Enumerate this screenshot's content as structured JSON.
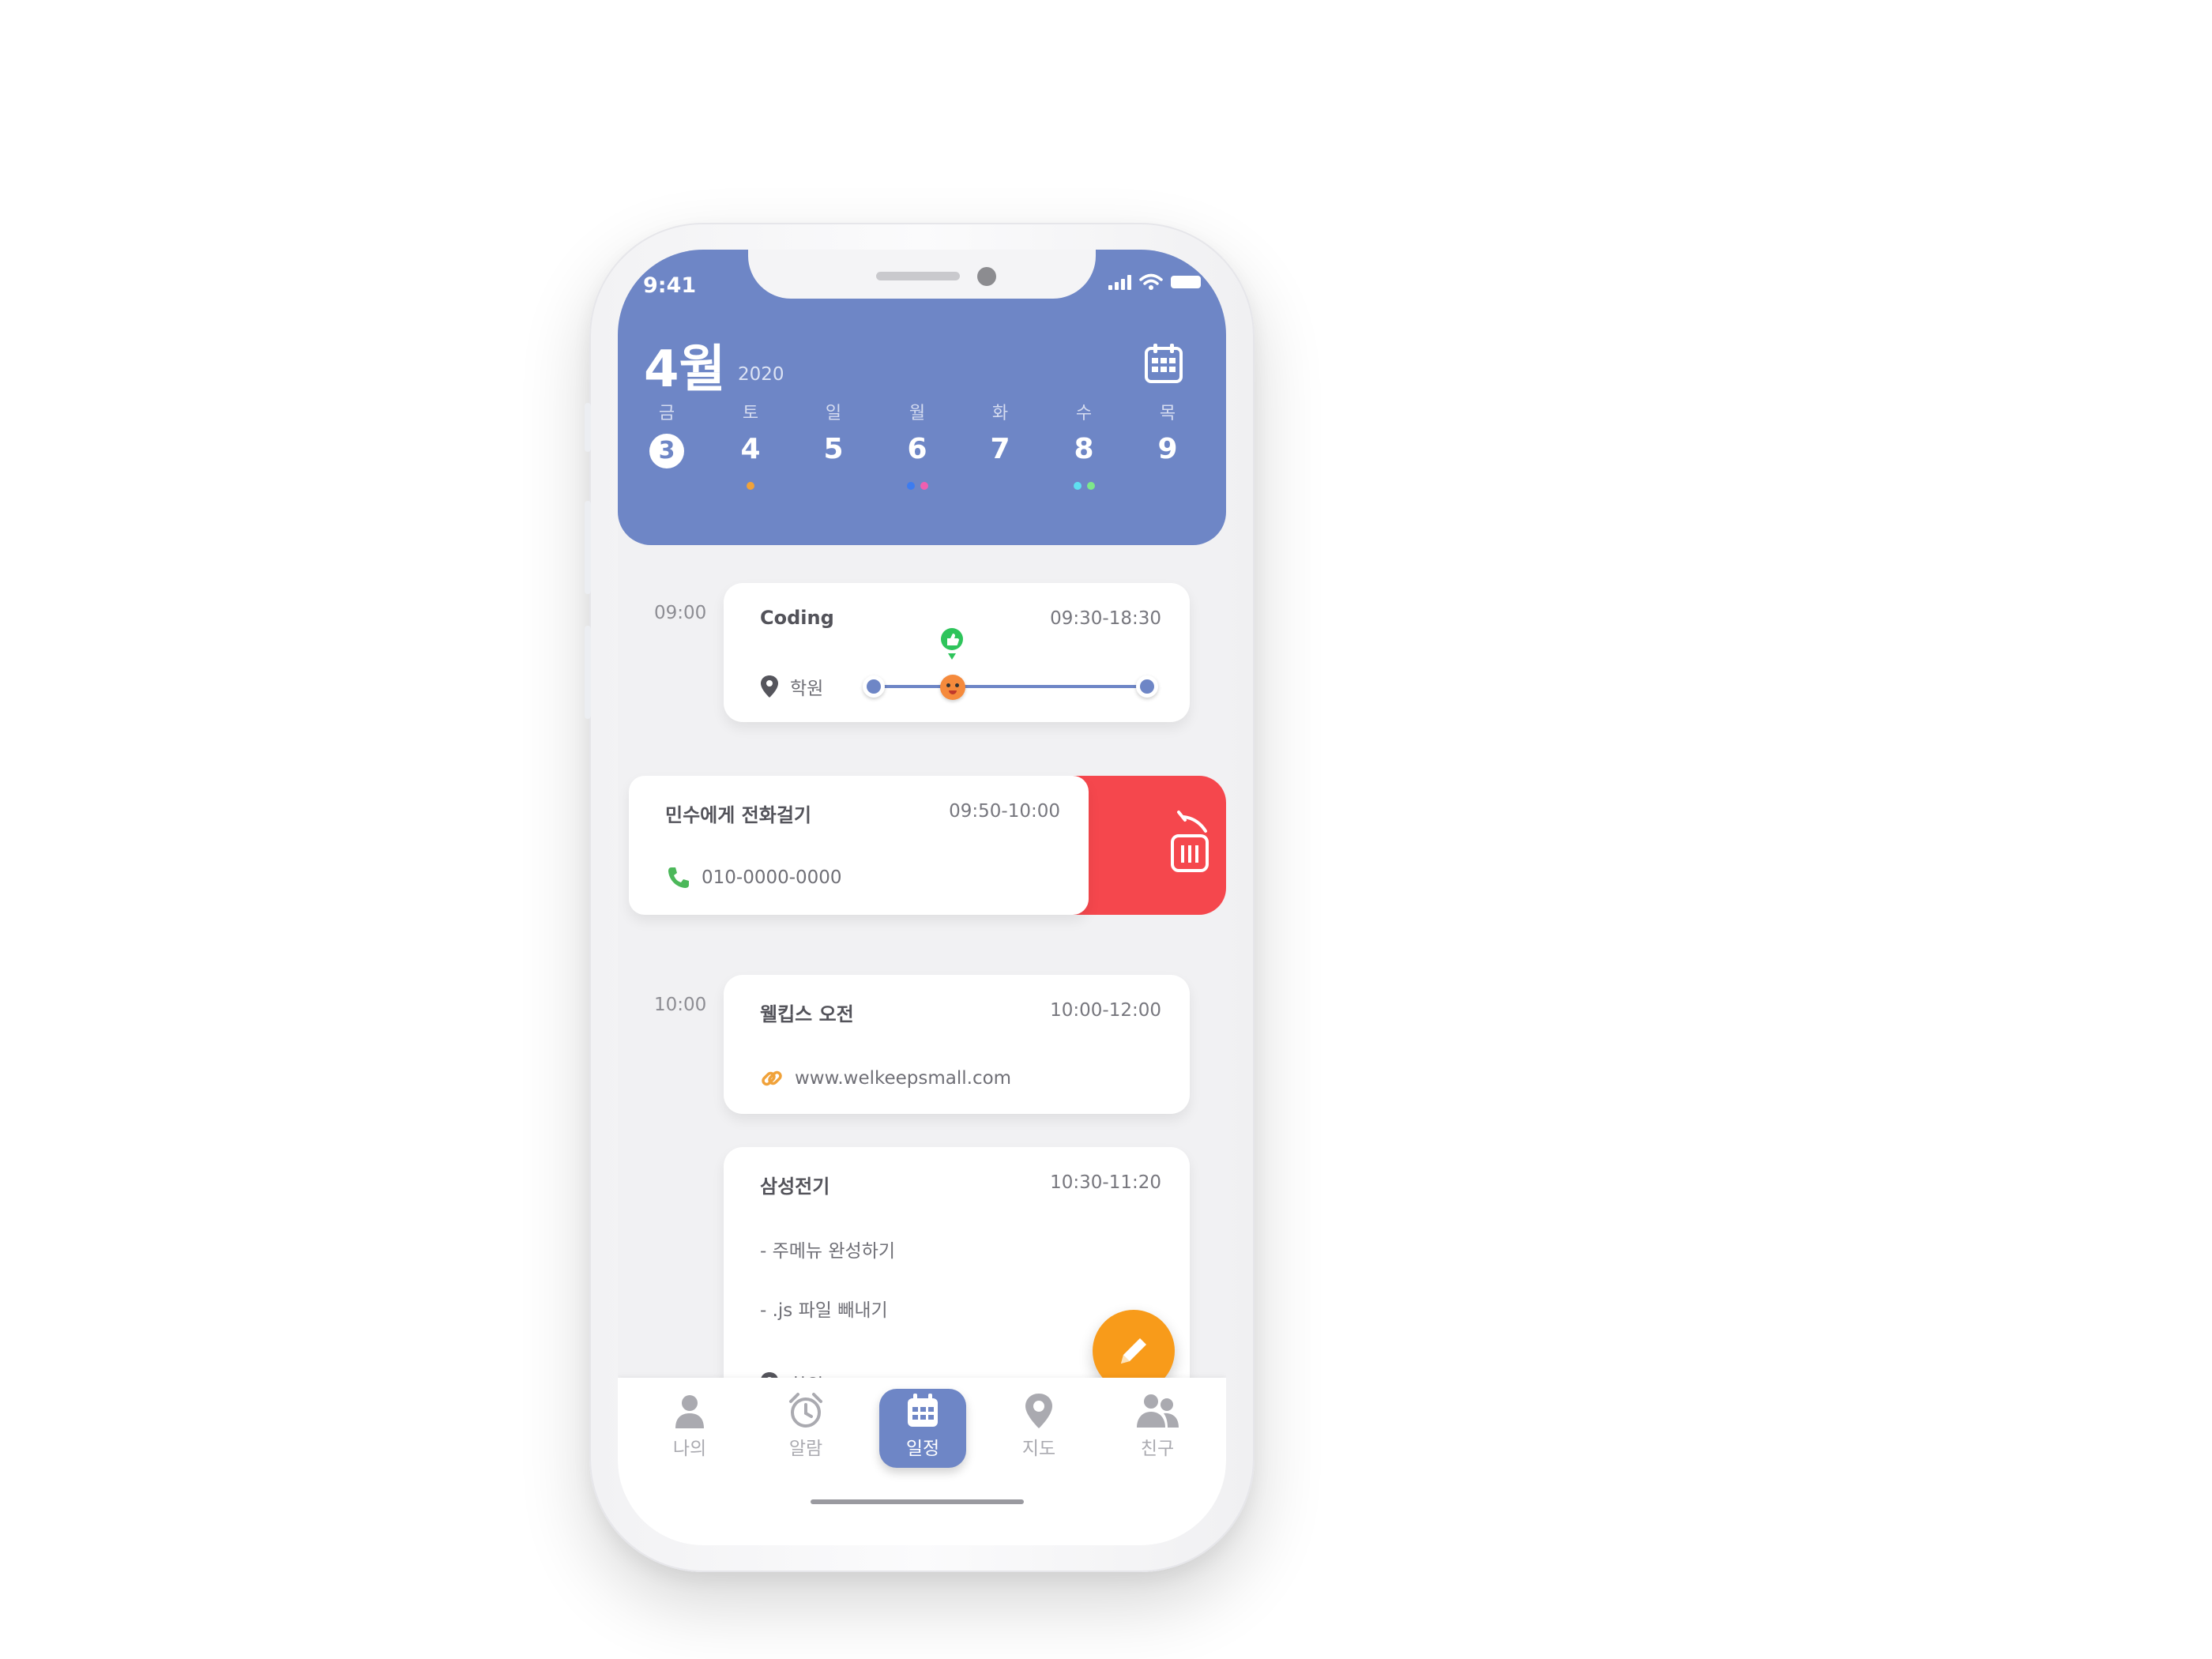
{
  "status_bar": {
    "time": "9:41"
  },
  "header": {
    "month": "4월",
    "year": "2020"
  },
  "week": [
    {
      "weekday": "금",
      "date": "3",
      "today": true,
      "dots": []
    },
    {
      "weekday": "토",
      "date": "4",
      "today": false,
      "dots": [
        "#f0a23a"
      ]
    },
    {
      "weekday": "일",
      "date": "5",
      "today": false,
      "dots": []
    },
    {
      "weekday": "월",
      "date": "6",
      "today": false,
      "dots": [
        "#3d7cf0",
        "#f05fb0"
      ]
    },
    {
      "weekday": "화",
      "date": "7",
      "today": false,
      "dots": []
    },
    {
      "weekday": "수",
      "date": "8",
      "today": false,
      "dots": [
        "#5fe0f0",
        "#7ee88a"
      ]
    },
    {
      "weekday": "목",
      "date": "9",
      "today": false,
      "dots": []
    }
  ],
  "time_labels": {
    "t1": "09:00",
    "t2": "10:00"
  },
  "events": {
    "coding": {
      "title": "Coding",
      "time": "09:30-18:30",
      "location": "학원",
      "progress": 0.29
    },
    "call": {
      "title": "민수에게 전화걸기",
      "time": "09:50-10:00",
      "phone": "010-0000-0000"
    },
    "welkeeps": {
      "title": "웰킵스 오전",
      "time": "10:00-12:00",
      "link": "www.welkeepsmall.com"
    },
    "samsung": {
      "title": "삼성전기",
      "time": "10:30-11:20",
      "task1": "- 주메뉴 완성하기",
      "task2": "- .js 파일 빼내기",
      "location": "학원"
    }
  },
  "tabs": {
    "me": "나의",
    "alarm": "알람",
    "schedule": "일정",
    "map": "지도",
    "friends": "친구"
  },
  "colors": {
    "header": "#6e86c6",
    "delete": "#f5474d",
    "fab": "#f89b1a",
    "call": "#4cb85a",
    "link": "#f0a23a"
  }
}
